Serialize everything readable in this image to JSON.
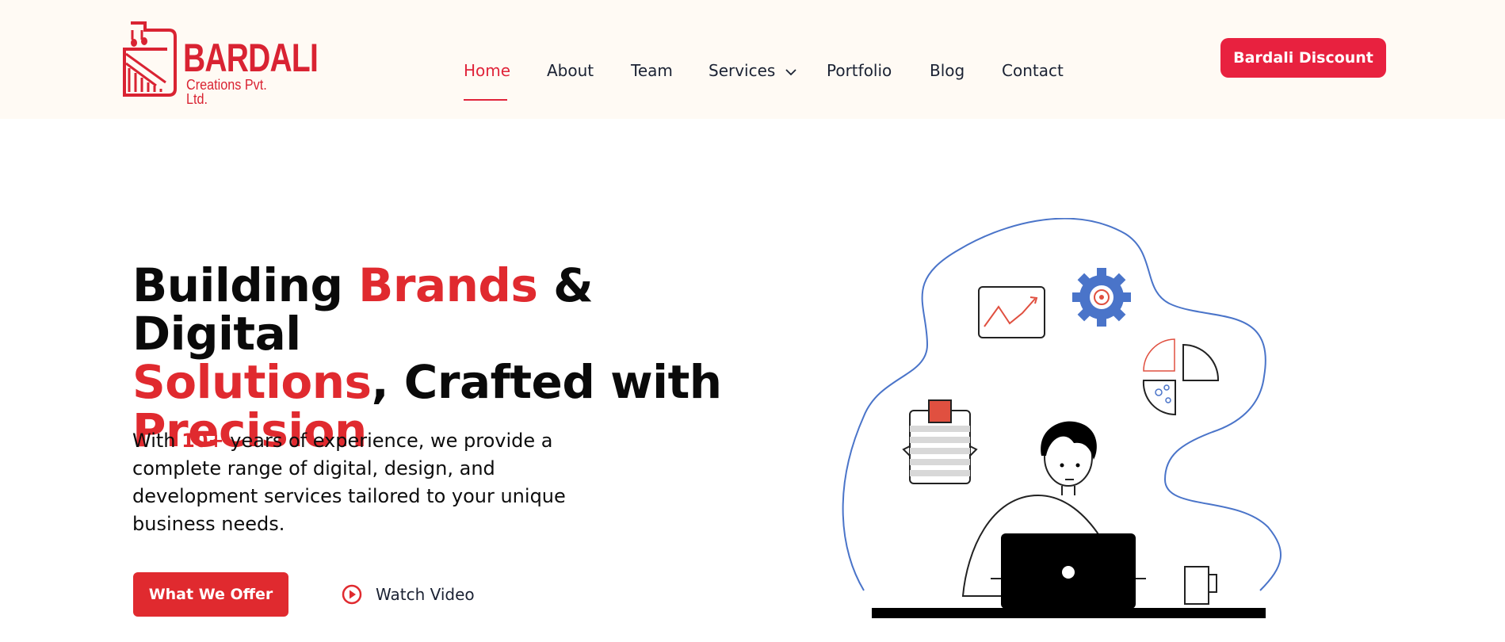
{
  "brand": {
    "name": "BARDALI",
    "subtitle": "Creations Pvt. Ltd.",
    "color": "#d92332"
  },
  "nav": {
    "items": [
      {
        "label": "Home",
        "active": true
      },
      {
        "label": "About"
      },
      {
        "label": "Team"
      },
      {
        "label": "Services",
        "has_dropdown": true,
        "icon": "chevron-down-icon"
      },
      {
        "label": "Portfolio"
      },
      {
        "label": "Blog"
      },
      {
        "label": "Contact"
      }
    ],
    "active_color": "#e0243a"
  },
  "header": {
    "cta_label": "Bardali Discount",
    "cta_color": "#e8213f",
    "background": "#fffaf4"
  },
  "hero": {
    "title": {
      "part1": "Building ",
      "highlight1": "Brands",
      "part2": " & Digital",
      "highlight2": "Solutions",
      "part3": ", Crafted with",
      "highlight3": "Precision"
    },
    "description": {
      "before": "With ",
      "highlight": "10+",
      "after": " years of experience, we provide a complete range of digital, design, and development services tailored to your unique business needs."
    },
    "primary_button": "What We Offer",
    "video_link": "Watch Video",
    "video_icon": "play-circle-icon",
    "accent_color": "#e02a2f"
  },
  "illustration": {
    "description_icons": [
      "chart-card-icon",
      "gear-icon",
      "pie-chart-icon",
      "document-icon",
      "laptop-icon",
      "mug-icon"
    ]
  }
}
